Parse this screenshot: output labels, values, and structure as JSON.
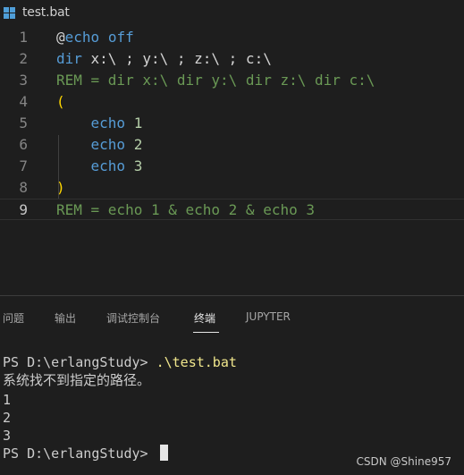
{
  "tab": {
    "title": "test.bat",
    "icon": "windows-batch-icon"
  },
  "editor": {
    "lines": [
      {
        "n": "1",
        "segments": [
          [
            "at",
            "@"
          ],
          [
            "kw",
            "echo"
          ],
          [
            "txt",
            " "
          ],
          [
            "kw",
            "off"
          ]
        ]
      },
      {
        "n": "2",
        "segments": [
          [
            "kw",
            "dir"
          ],
          [
            "txt",
            " x:\\ ; y:\\ ; z:\\ ; c:\\"
          ]
        ]
      },
      {
        "n": "3",
        "segments": [
          [
            "cm",
            "REM = dir x:\\ dir y:\\ dir z:\\ dir c:\\"
          ]
        ]
      },
      {
        "n": "4",
        "segments": [
          [
            "paren",
            "("
          ]
        ]
      },
      {
        "n": "5",
        "segments": [
          [
            "txt",
            "    "
          ],
          [
            "kw",
            "echo"
          ],
          [
            "txt",
            " "
          ],
          [
            "num",
            "1"
          ]
        ]
      },
      {
        "n": "6",
        "segments": [
          [
            "txt",
            "    "
          ],
          [
            "kw",
            "echo"
          ],
          [
            "txt",
            " "
          ],
          [
            "num",
            "2"
          ]
        ]
      },
      {
        "n": "7",
        "segments": [
          [
            "txt",
            "    "
          ],
          [
            "kw",
            "echo"
          ],
          [
            "txt",
            " "
          ],
          [
            "num",
            "3"
          ]
        ]
      },
      {
        "n": "8",
        "segments": [
          [
            "paren",
            ")"
          ]
        ]
      },
      {
        "n": "9",
        "segments": [
          [
            "cm",
            "REM = echo 1 & echo 2 & echo 3"
          ]
        ],
        "current": true
      }
    ]
  },
  "panel": {
    "tabs": [
      "问题",
      "输出",
      "调试控制台",
      "终端",
      "JUPYTER"
    ],
    "active_tab": "终端"
  },
  "terminal": {
    "prompt1": "PS D:\\erlangStudy> ",
    "command1": ".\\test.bat",
    "error": "系统找不到指定的路径。",
    "out1": "1",
    "out2": "2",
    "out3": "3",
    "prompt2": "PS D:\\erlangStudy> "
  },
  "watermark": "CSDN @Shine957",
  "colors": {
    "background": "#1e1e1e",
    "keyword": "#569cd6",
    "comment": "#6a9955",
    "number": "#b5cea8",
    "bracket": "#ffd700",
    "terminal_command": "#f0e68c"
  }
}
